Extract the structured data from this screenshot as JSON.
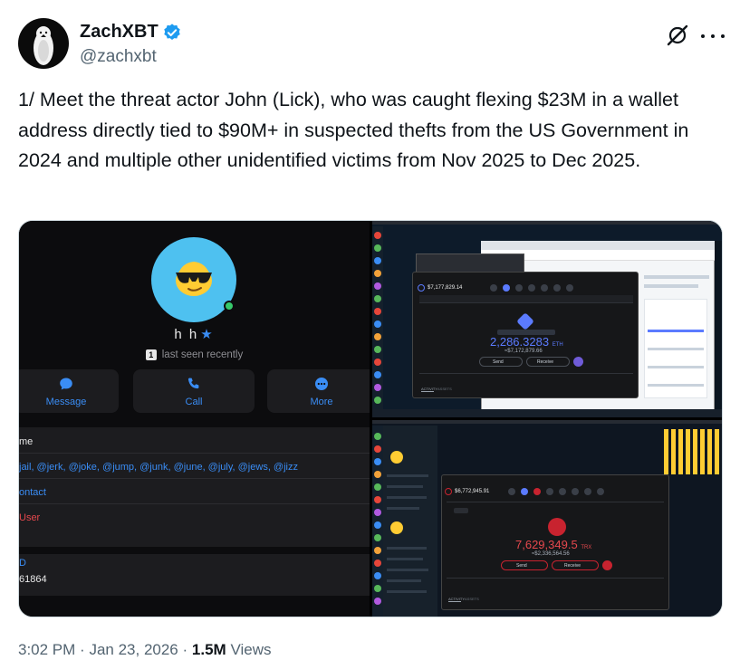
{
  "author": {
    "display_name": "ZachXBT",
    "handle": "@zachxbt",
    "verified": true
  },
  "tweet": {
    "text": "1/ Meet the threat actor John (Lick), who was caught flexing $23M in a wallet address directly tied to $90M+  in suspected thefts from the US Government in 2024 and multiple other unidentified victims from Nov 2025 to Dec 2025."
  },
  "meta": {
    "time": "3:02 PM",
    "date": "Jan 23, 2026",
    "separator": "·",
    "views_count": "1.5M",
    "views_label": "Views"
  },
  "media": {
    "profile": {
      "name": "h h",
      "last_seen": "last seen recently",
      "badge": "1",
      "buttons": [
        {
          "label": "Message",
          "icon": "message-bubble-icon"
        },
        {
          "label": "Call",
          "icon": "phone-icon"
        },
        {
          "label": "More",
          "icon": "more-dots-icon"
        }
      ],
      "username_label": "me",
      "usernames": "jail, @jerk, @joke, @jump, @junk, @june, @july, @jews, @jizz",
      "share_contact": "ontact",
      "block_user": "User",
      "id_label": "D",
      "id_value": "61864"
    },
    "screenshot_top": {
      "balance_small": "$7,177,829.14",
      "balance_eth": "2,286.3283",
      "unit": "ETH",
      "usd_value": "≈$7,172,879.66",
      "send_label": "Send",
      "receive_label": "Receive",
      "activity_tab": "ACTIVITY",
      "assets_tab": "ASSETS"
    },
    "screenshot_bottom": {
      "balance_small": "$6,772,945.91",
      "balance_trx": "7,629,349.5",
      "unit": "TRX",
      "usd_value": "≈$2,336,564.56",
      "send_label": "Send",
      "receive_label": "Receive",
      "activity_tab": "ACTIVITY",
      "assets_tab": "ASSETS"
    }
  },
  "colors": {
    "accent_blue": "#1d9bf0",
    "text_primary": "#0f1419",
    "text_secondary": "#536471",
    "telegram_blue": "#3a8df5",
    "danger_red": "#e5484d",
    "tron_red": "#c8232f",
    "eth_blue": "#5b7bff"
  }
}
